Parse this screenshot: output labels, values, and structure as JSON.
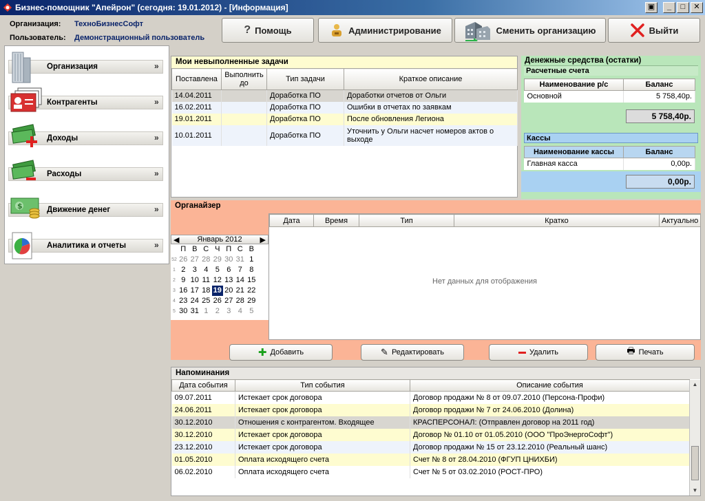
{
  "window": {
    "title": "Бизнес-помощник \"Апейрон\" (сегодня: 19.01.2012) - [Информация]",
    "buttons": [
      "▣",
      "_",
      "□",
      "✕"
    ]
  },
  "header": {
    "org_label": "Организация:",
    "org_value": "ТехноБизнесСофт",
    "user_label": "Пользователь:",
    "user_value": "Демонстрационный пользователь"
  },
  "toolbar": {
    "help": "Помощь",
    "admin": "Администрирование",
    "change_org": "Сменить организацию",
    "exit": "Выйти"
  },
  "sidebar": {
    "items": [
      {
        "label": "Организация",
        "icon": "building-icon"
      },
      {
        "label": "Контрагенты",
        "icon": "contacts-card-icon"
      },
      {
        "label": "Доходы",
        "icon": "money-plus-icon"
      },
      {
        "label": "Расходы",
        "icon": "money-minus-icon"
      },
      {
        "label": "Движение денег",
        "icon": "money-coins-icon"
      },
      {
        "label": "Аналитика и отчеты",
        "icon": "pie-report-icon"
      }
    ]
  },
  "tasks": {
    "title": "Мои невыполненные задачи",
    "columns": [
      "Поставлена",
      "Выполнить до",
      "Тип задачи",
      "Краткое описание"
    ],
    "rows": [
      [
        "14.04.2011",
        "",
        "Доработка ПО",
        "Доработки отчетов от Ольги"
      ],
      [
        "16.02.2011",
        "",
        "Доработка ПО",
        "Ошибки в отчетах по заявкам"
      ],
      [
        "19.01.2011",
        "",
        "Доработка ПО",
        "После обновления Легиона"
      ],
      [
        "10.01.2011",
        "",
        "Доработка ПО",
        "Уточнить у Ольги насчет номеров актов о выходе"
      ]
    ]
  },
  "money": {
    "title": "Денежные средства (остатки)",
    "accounts": {
      "title": "Расчетные счета",
      "columns": [
        "Наименование р/с",
        "Баланс"
      ],
      "rows": [
        [
          "Основной",
          "5 758,40р."
        ]
      ],
      "total": "5 758,40р."
    },
    "cash": {
      "title": "Кассы",
      "columns": [
        "Наименование кассы",
        "Баланс"
      ],
      "rows": [
        [
          "Главная касса",
          "0,00р."
        ]
      ],
      "total": "0,00р."
    }
  },
  "organizer": {
    "title": "Органайзер",
    "columns": [
      "Дата",
      "Время",
      "Тип",
      "Кратко",
      "Актуально"
    ],
    "empty": "Нет данных для отображения",
    "calendar": {
      "month": "Январь 2012",
      "weekdays": [
        "П",
        "В",
        "С",
        "Ч",
        "П",
        "С",
        "В"
      ],
      "weeks": [
        {
          "wk": "52",
          "days": [
            [
              "26",
              1
            ],
            [
              "27",
              1
            ],
            [
              "28",
              1
            ],
            [
              "29",
              1
            ],
            [
              "30",
              1
            ],
            [
              "31",
              1
            ],
            [
              "1",
              0
            ]
          ]
        },
        {
          "wk": "1",
          "days": [
            [
              "2",
              0
            ],
            [
              "3",
              0
            ],
            [
              "4",
              0
            ],
            [
              "5",
              0
            ],
            [
              "6",
              0
            ],
            [
              "7",
              0
            ],
            [
              "8",
              0
            ]
          ]
        },
        {
          "wk": "2",
          "days": [
            [
              "9",
              0
            ],
            [
              "10",
              0
            ],
            [
              "11",
              0
            ],
            [
              "12",
              0
            ],
            [
              "13",
              0
            ],
            [
              "14",
              0
            ],
            [
              "15",
              0
            ]
          ]
        },
        {
          "wk": "3",
          "days": [
            [
              "16",
              0
            ],
            [
              "17",
              0
            ],
            [
              "18",
              0
            ],
            [
              "19",
              2
            ],
            [
              "20",
              0
            ],
            [
              "21",
              0
            ],
            [
              "22",
              0
            ]
          ]
        },
        {
          "wk": "4",
          "days": [
            [
              "23",
              0
            ],
            [
              "24",
              0
            ],
            [
              "25",
              0
            ],
            [
              "26",
              0
            ],
            [
              "27",
              0
            ],
            [
              "28",
              0
            ],
            [
              "29",
              0
            ]
          ]
        },
        {
          "wk": "5",
          "days": [
            [
              "30",
              0
            ],
            [
              "31",
              0
            ],
            [
              "1",
              1
            ],
            [
              "2",
              1
            ],
            [
              "3",
              1
            ],
            [
              "4",
              1
            ],
            [
              "5",
              1
            ]
          ]
        }
      ]
    },
    "buttons": {
      "add": "Добавить",
      "edit": "Редактировать",
      "delete": "Удалить",
      "print": "Печать"
    }
  },
  "reminders": {
    "title": "Напоминания",
    "columns": [
      "Дата события",
      "Тип события",
      "Описание события"
    ],
    "rows": [
      [
        "09.07.2011",
        "Истекает срок договора",
        "Договор продажи № 8 от 09.07.2010 (Персона-Профи)"
      ],
      [
        "24.06.2011",
        "Истекает срок договора",
        "Договор продажи № 7 от 24.06.2010 (Долина)"
      ],
      [
        "30.12.2010",
        "Отношения с контрагентом. Входящее",
        "КРАСПЕРСОНАЛ: (Отправлен договор на 2011 год)"
      ],
      [
        "30.12.2010",
        "Истекает срок договора",
        "Договор № 01.10 от 01.05.2010 (ООО \"ПроЭнергоСофт\")"
      ],
      [
        "23.12.2010",
        "Истекает срок договора",
        "Договор продажи № 15 от 23.12.2010 (Реальный шанс)"
      ],
      [
        "01.05.2010",
        "Оплата исходящего счета",
        "Счет № 8 от 28.04.2010 (ФГУП ЦНИХБИ)"
      ],
      [
        "06.02.2010",
        "Оплата исходящего счета",
        "Счет № 5 от 03.02.2010 (РОСТ-ПРО)"
      ]
    ]
  },
  "colors": {
    "tasks_header": "#fefcd0",
    "money_bg": "#b9e6ba",
    "organizer_bg": "#fbb496",
    "selection": "#0a246a",
    "accent": "#0a246a"
  }
}
